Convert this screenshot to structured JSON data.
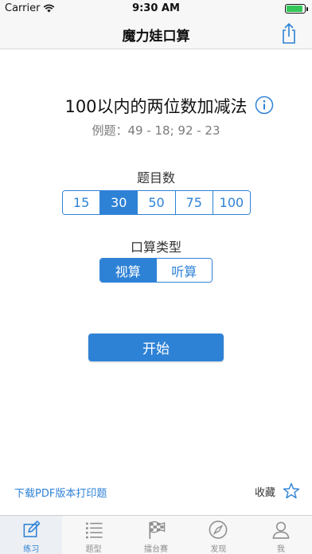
{
  "status_bar": {
    "carrier": "Carrier",
    "time": "9:30 AM",
    "battery_level": 0.95,
    "battery_color": "#34c759"
  },
  "nav": {
    "title": "魔力娃口算",
    "share_icon": "share-icon"
  },
  "topic": {
    "title": "100以内的两位数加减法",
    "example": "例题：49 - 18; 92 - 23"
  },
  "count": {
    "label": "题目数",
    "options": [
      "15",
      "30",
      "50",
      "75",
      "100"
    ],
    "selected": "30"
  },
  "mode": {
    "label": "口算类型",
    "options": [
      "视算",
      "听算"
    ],
    "selected": "视算"
  },
  "start_label": "开始",
  "pdf_link": "下载PDF版本打印题",
  "favorite_label": "收藏",
  "tabs": [
    {
      "label": "练习",
      "icon": "edit-icon",
      "active": true
    },
    {
      "label": "题型",
      "icon": "list-icon",
      "active": false
    },
    {
      "label": "擂台赛",
      "icon": "checkered-flag-icon",
      "active": false
    },
    {
      "label": "发现",
      "icon": "compass-icon",
      "active": false
    },
    {
      "label": "我",
      "icon": "user-icon",
      "active": false
    }
  ],
  "colors": {
    "accent": "#2e82d6",
    "inactive": "#8e8e8e"
  }
}
